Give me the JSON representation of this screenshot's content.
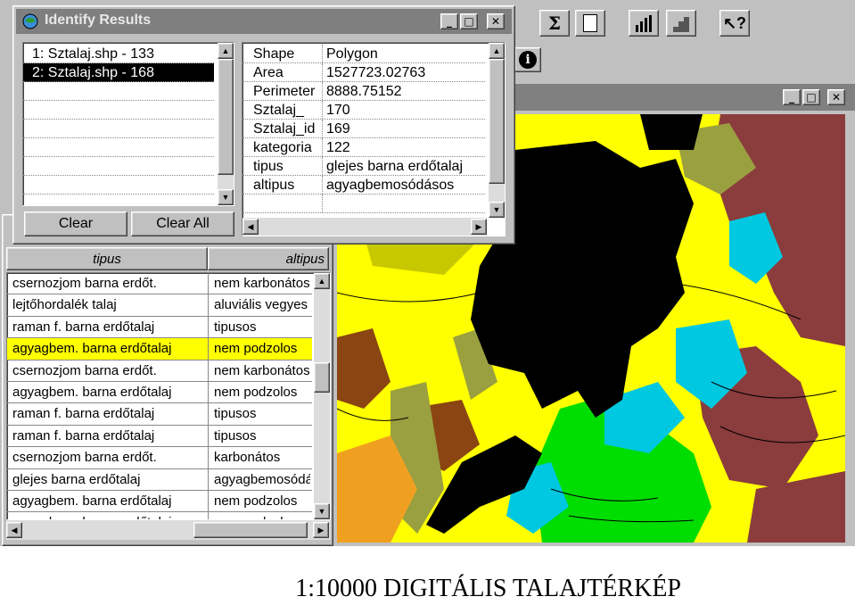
{
  "identify": {
    "title": "Identify Results",
    "results": [
      "1:  Sztalaj.shp - 133",
      "2:  Sztalaj.shp - 168"
    ],
    "selected_index": 1,
    "clear_label": "Clear",
    "clear_all_label": "Clear All",
    "attributes": [
      {
        "key": "Shape",
        "value": "Polygon"
      },
      {
        "key": "Area",
        "value": "1527723.02763"
      },
      {
        "key": "Perimeter",
        "value": "8888.75152"
      },
      {
        "key": "Sztalaj_",
        "value": "170"
      },
      {
        "key": "Sztalaj_id",
        "value": "169"
      },
      {
        "key": "kategoria",
        "value": "122"
      },
      {
        "key": "tipus",
        "value": "glejes barna erdőtalaj"
      },
      {
        "key": "altipus",
        "value": "agyagbemosódásos"
      }
    ]
  },
  "toolbar": {
    "icons": [
      "sigma-icon",
      "calculator-icon",
      "bar-chart-icon",
      "histogram-icon",
      "help-pointer-icon"
    ],
    "info_icon": "info-icon"
  },
  "table": {
    "headers": [
      "tipus",
      "altipus"
    ],
    "rows": [
      {
        "tipus": "csernozjom barna erdőt.",
        "altipus": "nem karbonátos"
      },
      {
        "tipus": "lejtőhordalék talaj",
        "altipus": "aluviális vegyes"
      },
      {
        "tipus": "raman f. barna erdőtalaj",
        "altipus": "tipusos"
      },
      {
        "tipus": "agyagbem. barna erdőtalaj",
        "altipus": "nem podzolos",
        "highlight": true
      },
      {
        "tipus": "csernozjom barna erdőt.",
        "altipus": "nem karbonátos"
      },
      {
        "tipus": "agyagbem. barna erdőtalaj",
        "altipus": "nem podzolos"
      },
      {
        "tipus": "raman f. barna erdőtalaj",
        "altipus": "tipusos"
      },
      {
        "tipus": "raman f. barna erdőtalaj",
        "altipus": "tipusos"
      },
      {
        "tipus": "csernozjom barna erdőt.",
        "altipus": "karbonátos"
      },
      {
        "tipus": "glejes barna erdőtalaj",
        "altipus": "agyagbemosódásos"
      },
      {
        "tipus": "agyagbem. barna erdőtalaj",
        "altipus": "nem podzolos"
      },
      {
        "tipus": "agyagbem. barna erdőtalaj",
        "altipus": "nem podzolos"
      }
    ]
  },
  "map_window": {
    "buttons": [
      "minimize",
      "maximize",
      "close"
    ]
  },
  "caption": "1:10000 DIGITÁLIS TALAJTÉRKÉP",
  "colors": {
    "title_bar": "#7f7f7f",
    "highlight_row": "#ffff00",
    "map_yellow": "#ffff00",
    "map_brown": "#8b3c3c",
    "map_dark_brown": "#8b4513",
    "map_olive": "#9aa040",
    "map_green": "#00dd00",
    "map_cyan": "#00c8e0",
    "map_orange": "#f0a020",
    "map_black": "#000000"
  }
}
